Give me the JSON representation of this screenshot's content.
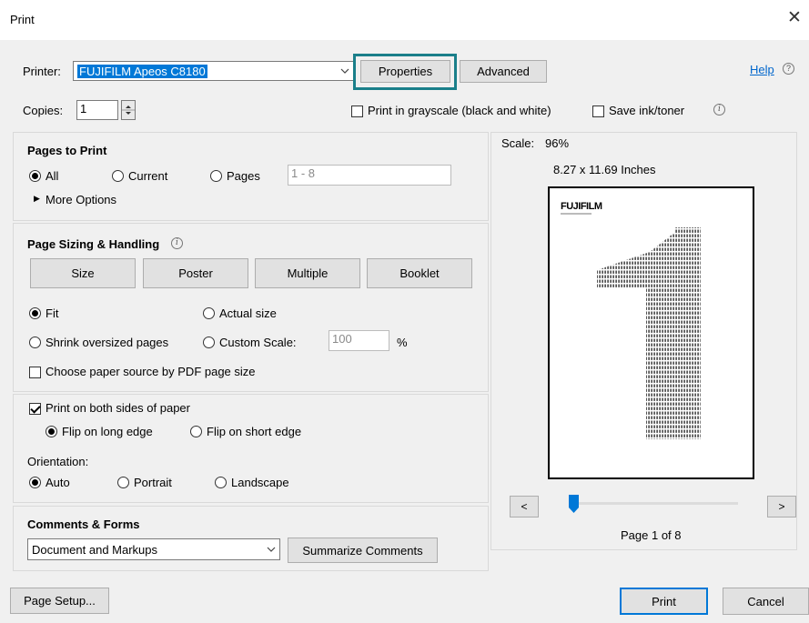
{
  "window": {
    "title": "Print",
    "close_glyph": "✕"
  },
  "printer": {
    "label": "Printer:",
    "selected": "FUJIFILM Apeos C8180",
    "properties_button": "Properties",
    "advanced_button": "Advanced",
    "help_link": "Help",
    "help_icon": "?"
  },
  "copies": {
    "label": "Copies:",
    "value": "1",
    "grayscale_label": "Print in grayscale (black and white)",
    "grayscale_checked": false,
    "save_ink_label": "Save ink/toner",
    "save_ink_checked": false
  },
  "pages_to_print": {
    "title": "Pages to Print",
    "all_label": "All",
    "current_label": "Current",
    "pages_label": "Pages",
    "pages_value": "1 - 8",
    "more_options": "More Options",
    "selected": "all"
  },
  "sizing": {
    "title": "Page Sizing & Handling",
    "size_button": "Size",
    "poster_button": "Poster",
    "multiple_button": "Multiple",
    "booklet_button": "Booklet",
    "fit_label": "Fit",
    "actual_size_label": "Actual size",
    "shrink_label": "Shrink oversized pages",
    "custom_scale_label": "Custom Scale:",
    "custom_scale_value": "100",
    "percent": "%",
    "paper_source_label": "Choose paper source by PDF page size",
    "selected": "fit"
  },
  "duplex": {
    "both_sides_label": "Print on both sides of paper",
    "both_sides_checked": true,
    "long_edge_label": "Flip on long edge",
    "short_edge_label": "Flip on short edge",
    "selected": "long"
  },
  "orientation": {
    "label": "Orientation:",
    "auto_label": "Auto",
    "portrait_label": "Portrait",
    "landscape_label": "Landscape",
    "selected": "auto"
  },
  "comments": {
    "title": "Comments & Forms",
    "selected": "Document and Markups",
    "summarize_button": "Summarize Comments"
  },
  "preview": {
    "scale_label": "Scale:",
    "scale_value": "96%",
    "dimensions": "8.27 x 11.69 Inches",
    "logo_text": "FUJIFILM",
    "prev_button": "<",
    "next_button": ">",
    "page_indicator": "Page 1 of 8",
    "slider_position": 0.0
  },
  "footer": {
    "page_setup_button": "Page Setup...",
    "print_button": "Print",
    "cancel_button": "Cancel"
  },
  "colors": {
    "focus_highlight": "#1a7f8a",
    "selection_bg": "#0078d7",
    "primary_button_border": "#0078d7",
    "slider_thumb": "#0078d7",
    "link": "#0066cc"
  }
}
